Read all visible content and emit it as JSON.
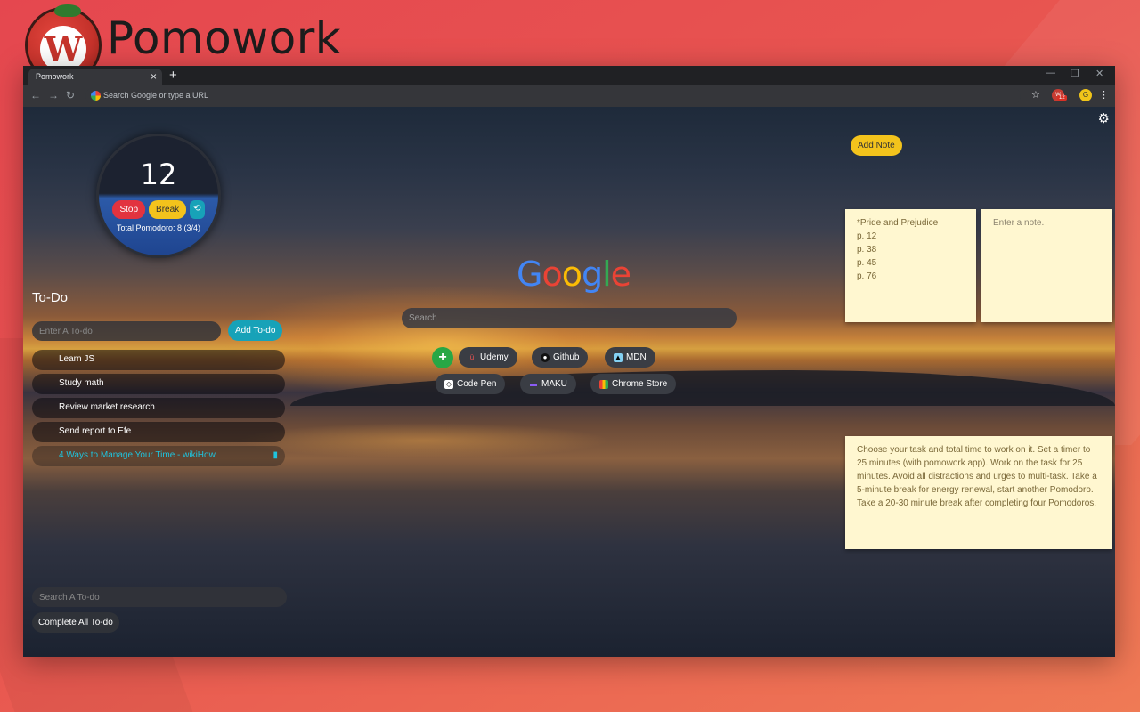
{
  "brand": {
    "initial": "W",
    "name": "Pomowork"
  },
  "browser": {
    "tab_title": "Pomowork",
    "tab_close": "×",
    "new_tab": "+",
    "omnibox_placeholder": "Search Google or type a URL",
    "extension_count": "12",
    "profile_initial": "G"
  },
  "timer": {
    "count": "12",
    "stop_label": "Stop",
    "break_label": "Break",
    "total_label": "Total Pomodoro: 8 (3/4)"
  },
  "todo": {
    "title": "To-Do",
    "input_placeholder": "Enter A To-do",
    "add_label": "Add To-do",
    "items": [
      {
        "label": "Learn JS"
      },
      {
        "label": "Study math"
      },
      {
        "label": "Review market research"
      },
      {
        "label": "Send report to Efe"
      },
      {
        "label": "4 Ways to Manage Your Time - wikiHow"
      }
    ],
    "search_placeholder": "Search A To-do",
    "complete_all_label": "Complete All To-do"
  },
  "google": {
    "letters": [
      "G",
      "o",
      "o",
      "g",
      "l",
      "e"
    ],
    "colors": [
      "#4285f4",
      "#ea4335",
      "#fbbc05",
      "#4285f4",
      "#34a853",
      "#ea4335"
    ],
    "search_placeholder": "Search",
    "add_shortcut": "+",
    "shortcuts": [
      {
        "label": "Udemy",
        "icon": "udemy-icon"
      },
      {
        "label": "Github",
        "icon": "github-icon"
      },
      {
        "label": "MDN",
        "icon": "mdn-icon"
      },
      {
        "label": "Code Pen",
        "icon": "codepen-icon"
      },
      {
        "label": "MAKU",
        "icon": "maku-icon"
      },
      {
        "label": "Chrome Store",
        "icon": "chrome-store-icon"
      }
    ]
  },
  "notes": {
    "add_label": "Add Note",
    "note1": [
      "*Pride and Prejudice",
      "p. 12",
      "p. 38",
      "p. 45",
      "p. 76"
    ],
    "note2_placeholder": "Enter a note.",
    "note3": "Choose your task and total time to work on it. Set a timer to 25 minutes (with pomowork app). Work on the task for 25 minutes.  Avoid all distractions and urges to multi-task. Take a 5-minute break for energy renewal, start another Pomodoro. Take a 20-30 minute break after completing four Pomodoros."
  },
  "colors": {
    "accent_teal": "#17a2b8",
    "stop_red": "#e2333f",
    "break_yellow": "#f3c31c",
    "note_bg": "#fff7d0",
    "add_green": "#28a745"
  }
}
